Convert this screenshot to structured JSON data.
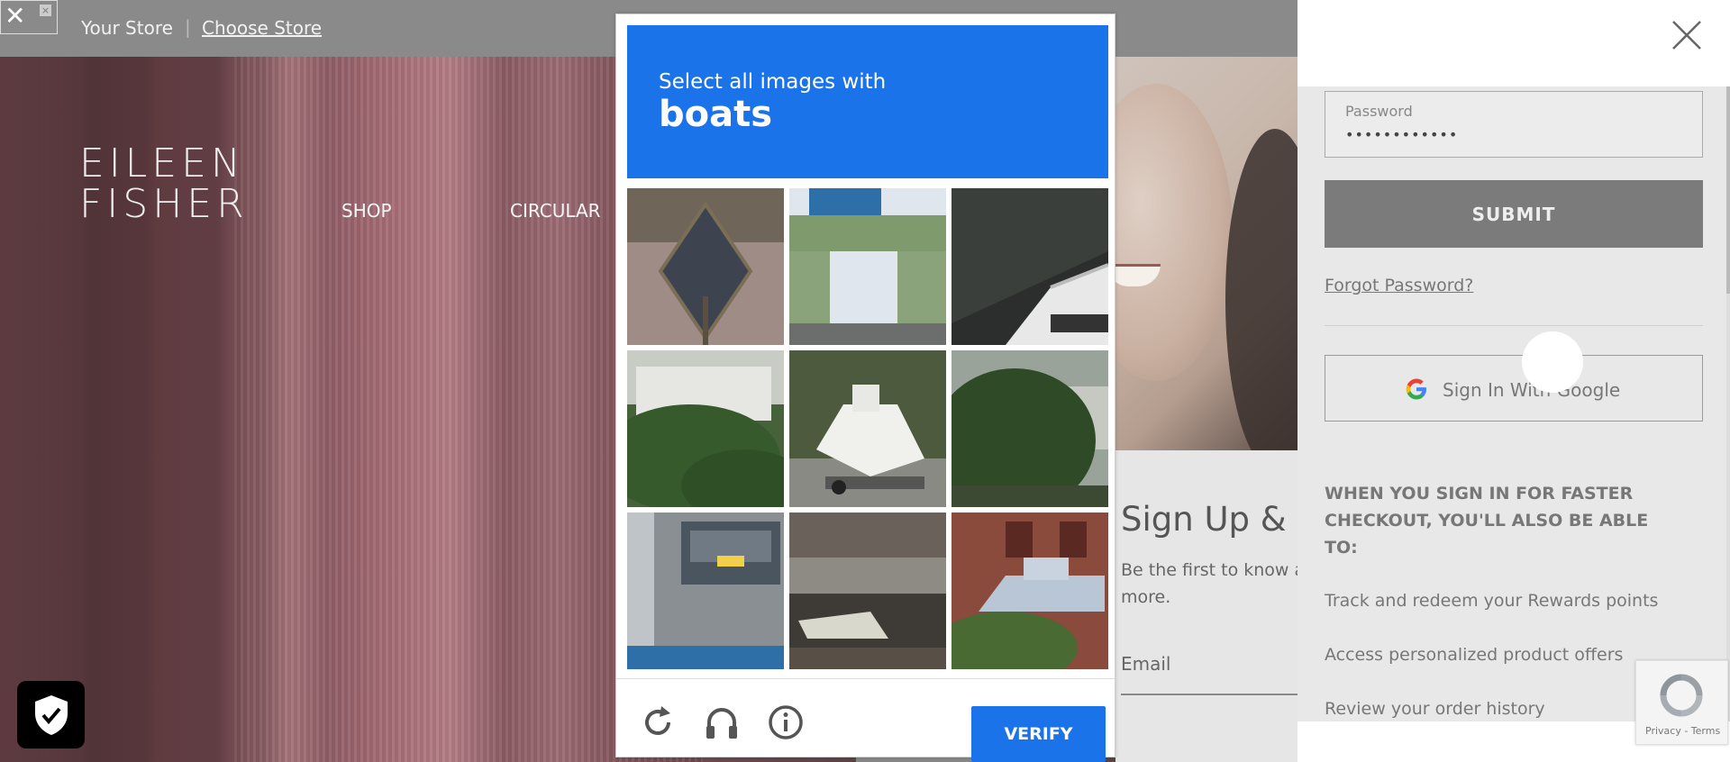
{
  "topbar": {
    "your_store": "Your Store",
    "separator": "|",
    "choose_store": "Choose Store"
  },
  "brand": {
    "line1": "EILEEN",
    "line2": "FISHER"
  },
  "nav": {
    "items": [
      "SHOP",
      "CIRCULAR"
    ]
  },
  "signup": {
    "title": "Sign Up & E",
    "text": "Be the first to know a and more.",
    "email_label": "Email"
  },
  "captcha": {
    "instruction": "Select all images with",
    "target": "boats",
    "verify_label": "VERIFY",
    "tiles": [
      "road-sign",
      "water-tower",
      "boat-deck",
      "trailer-shrubs",
      "boat-on-trailer",
      "trees",
      "car-carport",
      "canal-boat",
      "boat-by-building"
    ]
  },
  "drawer": {
    "password_label": "Password",
    "password_value": "••••••••••••",
    "submit_label": "SUBMIT",
    "forgot_label": "Forgot Password?",
    "google_label": "Sign In With Google",
    "benefits_heading": "WHEN YOU SIGN IN FOR FASTER CHECKOUT, YOU'LL ALSO BE ABLE TO:",
    "benefits": [
      "Track and redeem your Rewards points",
      "Access personalized product offers",
      "Review your order history"
    ]
  },
  "recaptcha": {
    "links": "Privacy - Terms"
  },
  "colors": {
    "captcha_blue": "#1a73e8",
    "submit_gray": "#7b7b7b",
    "topbar_gray": "#8a8a8a"
  },
  "icons": [
    "tools-icon",
    "close-small-icon",
    "refresh-icon",
    "headphones-icon",
    "info-icon",
    "close-icon",
    "google-g-icon",
    "shield-check-icon",
    "recaptcha-icon"
  ]
}
